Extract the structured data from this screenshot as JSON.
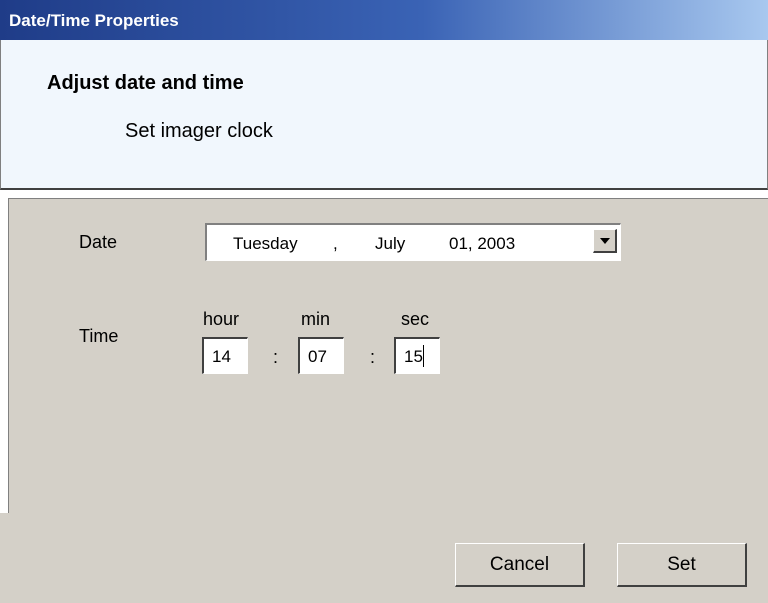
{
  "window": {
    "title": "Date/Time Properties"
  },
  "header": {
    "title": "Adjust date and time",
    "subtitle": "Set imager clock"
  },
  "date": {
    "label": "Date",
    "weekday": "Tuesday",
    "sep": ",",
    "month": "July",
    "day_year": "01, 2003"
  },
  "time": {
    "label": "Time",
    "hour_label": "hour",
    "min_label": "min",
    "sec_label": "sec",
    "hour": "14",
    "min": "07",
    "sec": "15",
    "separator": ":"
  },
  "buttons": {
    "cancel": "Cancel",
    "set": "Set"
  }
}
